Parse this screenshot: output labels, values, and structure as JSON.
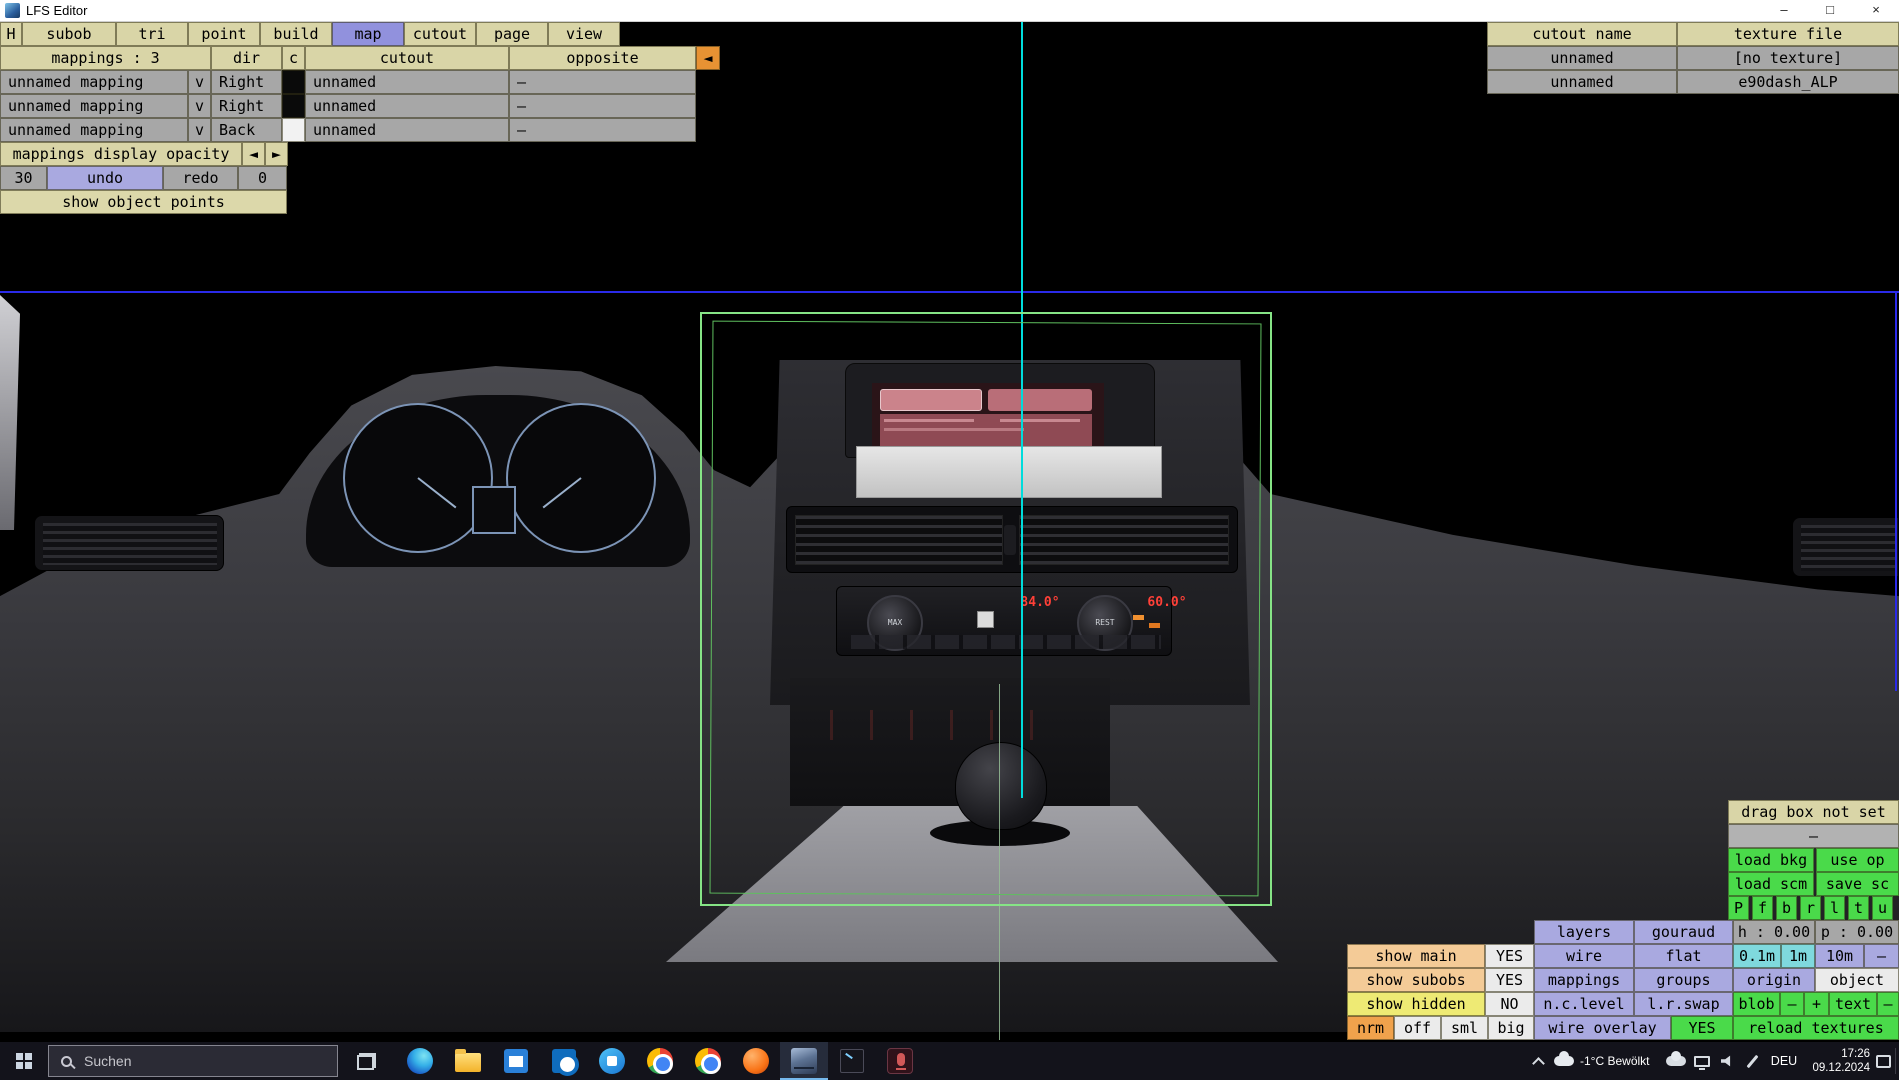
{
  "window": {
    "title": "LFS Editor",
    "minimize": "–",
    "maximize": "□",
    "close": "×"
  },
  "menu": {
    "h": "H",
    "subob": "subob",
    "tri": "tri",
    "point": "point",
    "build": "build",
    "map": "map",
    "cutout": "cutout",
    "page": "page",
    "view": "view"
  },
  "mappings_panel": {
    "header_mappings": "mappings : 3",
    "header_dir": "dir",
    "header_c": "c",
    "header_cutout": "cutout",
    "header_opposite": "opposite",
    "collapse_arrow": "◄",
    "rows": [
      {
        "name": "unnamed mapping",
        "v": "v",
        "dir": "Right",
        "swatch": "#000000",
        "cutout": "unnamed",
        "opposite": "–"
      },
      {
        "name": "unnamed mapping",
        "v": "v",
        "dir": "Right",
        "swatch": "#000000",
        "cutout": "unnamed",
        "opposite": "–"
      },
      {
        "name": "unnamed mapping",
        "v": "v",
        "dir": "Back",
        "swatch": "#ffffff",
        "cutout": "unnamed",
        "opposite": "–"
      }
    ],
    "opacity_label": "mappings display opacity",
    "opacity_left": "◄",
    "opacity_right": "►",
    "opacity_value": "30",
    "undo": "undo",
    "redo": "redo",
    "redo_count": "0",
    "show_object_points": "show object points"
  },
  "cutout_panel": {
    "header_name": "cutout name",
    "header_file": "texture file",
    "rows": [
      {
        "name": "unnamed",
        "file": "[no texture]"
      },
      {
        "name": "unnamed",
        "file": "e90dash_ALP"
      }
    ]
  },
  "view_panel": {
    "drag_box": "drag box not set",
    "placeholder_dash": "–",
    "load_bkg": "load bkg",
    "use_op": "use op",
    "load_scm": "load scm",
    "save_sc": "save sc",
    "face_buttons": [
      "P",
      "f",
      "b",
      "r",
      "l",
      "t",
      "u"
    ],
    "layers": "layers",
    "gouraud": "gouraud",
    "h_value": "h : 0.00",
    "p_value": "p : 0.00",
    "show_main": "show main",
    "show_main_value": "YES",
    "wire": "wire",
    "flat": "flat",
    "grid_01m": "0.1m",
    "grid_1m": "1m",
    "grid_10m": "10m",
    "grid_dash": "–",
    "show_subobs": "show subobs",
    "show_subobs_value": "YES",
    "mappings": "mappings",
    "groups": "groups",
    "origin": "origin",
    "object": "object",
    "show_hidden": "show hidden",
    "show_hidden_value": "NO",
    "nc_level": "n.c.level",
    "lr_swap": "l.r.swap",
    "blob": "blob",
    "blob_minus": "–",
    "blob_plus": "+",
    "text_button": "text",
    "text_minus": "–",
    "nrm": "nrm",
    "off": "off",
    "sml": "sml",
    "big": "big",
    "wire_overlay": "wire overlay",
    "wire_overlay_value": "YES",
    "reload_textures": "reload textures"
  },
  "viewport": {
    "selection_box_color": "#86e486",
    "horizontal_axis_color": "#2a2ae8",
    "vertical_axis_color": "#00dcdc",
    "climate": {
      "temp_left": "84.0°",
      "temp_right": "60.0°",
      "knob_left_label": "MAX",
      "knob_right_label": "REST"
    }
  },
  "taskbar": {
    "search": "Suchen",
    "apps": [
      "edge",
      "file-explorer",
      "store",
      "outlook",
      "teams",
      "chrome",
      "chrome",
      "browser",
      "lfs-editor",
      "terminal",
      "recorder"
    ],
    "active_app": "lfs-editor",
    "tray": {
      "weather": "-1°C Bewölkt",
      "language": "DEU",
      "time": "17:26",
      "date": "09.12.2024"
    }
  }
}
